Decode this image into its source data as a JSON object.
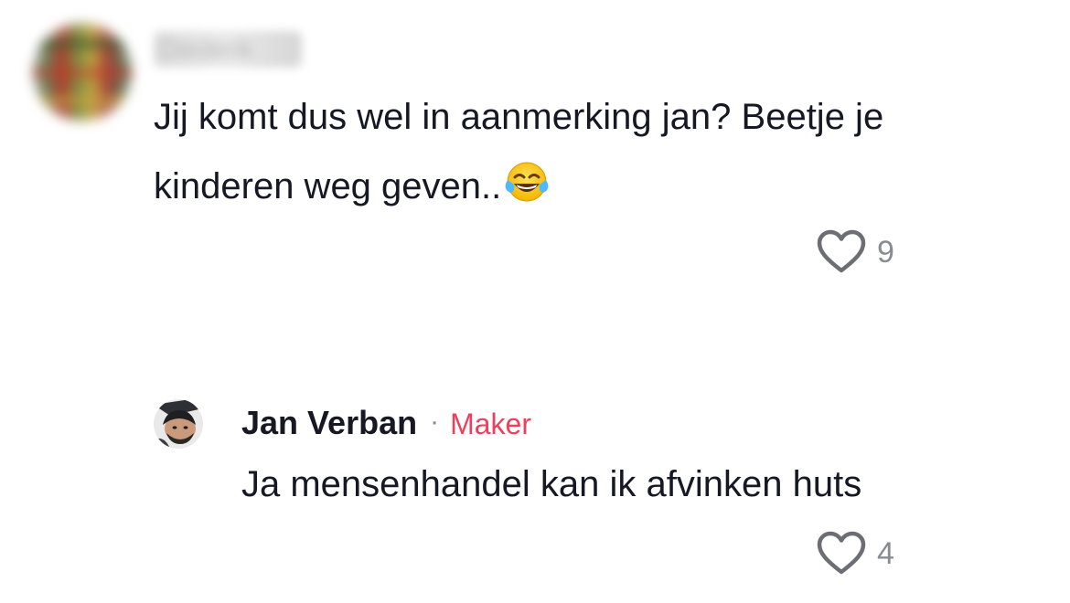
{
  "comment": {
    "username": "Diederik",
    "text": "Jij komt dus wel in aanmerking jan? Beetje je kinderen weg geven..",
    "emoji": "face-with-tears-of-joy",
    "like_count": "9"
  },
  "reply": {
    "author": "Jan Verban",
    "separator": "·",
    "badge": "Maker",
    "text": "Ja mensenhandel kan ik afvinken huts",
    "like_count": "4"
  },
  "colors": {
    "text": "#161823",
    "muted": "#8a8b91",
    "creator_badge": "#ee3f5c",
    "heart_outline": "#6d6e73"
  }
}
